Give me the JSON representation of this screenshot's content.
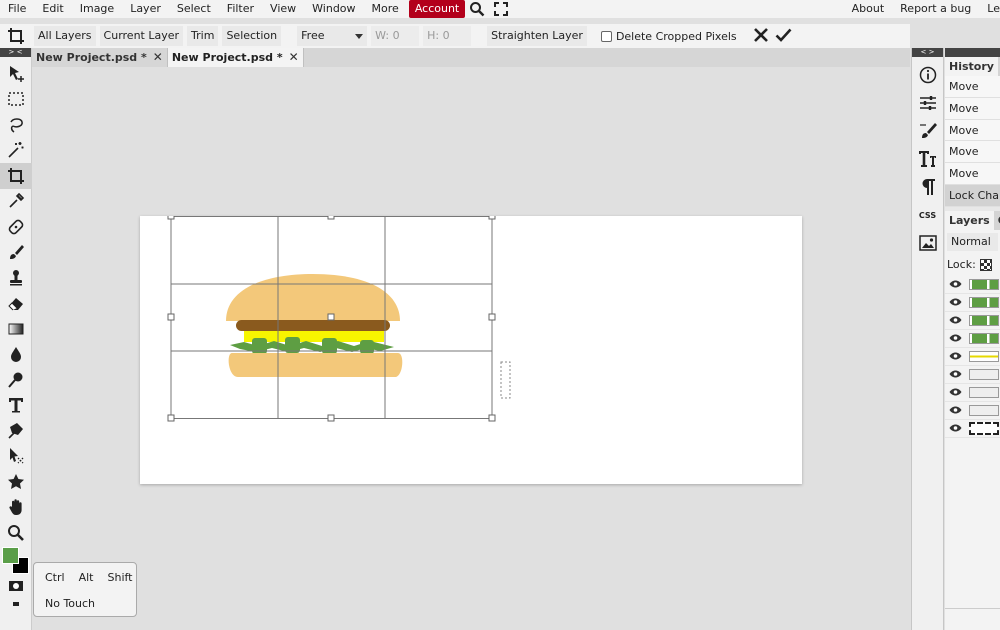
{
  "menu": {
    "items": [
      "File",
      "Edit",
      "Image",
      "Layer",
      "Select",
      "Filter",
      "View",
      "Window",
      "More"
    ],
    "account": "Account",
    "right_links": [
      "About",
      "Report a bug",
      "Le"
    ]
  },
  "options": {
    "buttons": [
      "All Layers",
      "Current Layer",
      "Trim",
      "Selection"
    ],
    "ratio_value": "Free",
    "width_label": "W:",
    "width_value": "0",
    "height_label": "H:",
    "height_value": "0",
    "straighten": "Straighten Layer",
    "delete_cropped": "Delete Cropped Pixels"
  },
  "toolbar_head": "> <",
  "tabs": [
    {
      "label": "New Project.psd *",
      "active": false
    },
    {
      "label": "New Project.psd *",
      "active": true
    }
  ],
  "colors": {
    "foreground": "#5a9e48",
    "background": "#000000",
    "account_bg": "#b3001b",
    "bun": "#f3c87a",
    "patty": "#8a5a1e",
    "cheese": "#f7f500",
    "lettuce": "#5e9e43"
  },
  "right_strip": {
    "head": "< >",
    "icons": [
      "info-icon",
      "adjustments-icon",
      "brush-settings-icon",
      "character-icon",
      "paragraph-icon",
      "css-icon",
      "image-icon"
    ],
    "css_label": "CSS"
  },
  "history": {
    "tabs": [
      "History",
      "S"
    ],
    "items": [
      "Move",
      "Move",
      "Move",
      "Move",
      "Move",
      "Lock Chang"
    ]
  },
  "layers": {
    "tabs": [
      "Layers",
      "C"
    ],
    "blend_mode": "Normal",
    "lock_label": "Lock:"
  },
  "keys": {
    "modifiers": [
      "Ctrl",
      "Alt",
      "Shift"
    ],
    "touch": "No Touch"
  }
}
